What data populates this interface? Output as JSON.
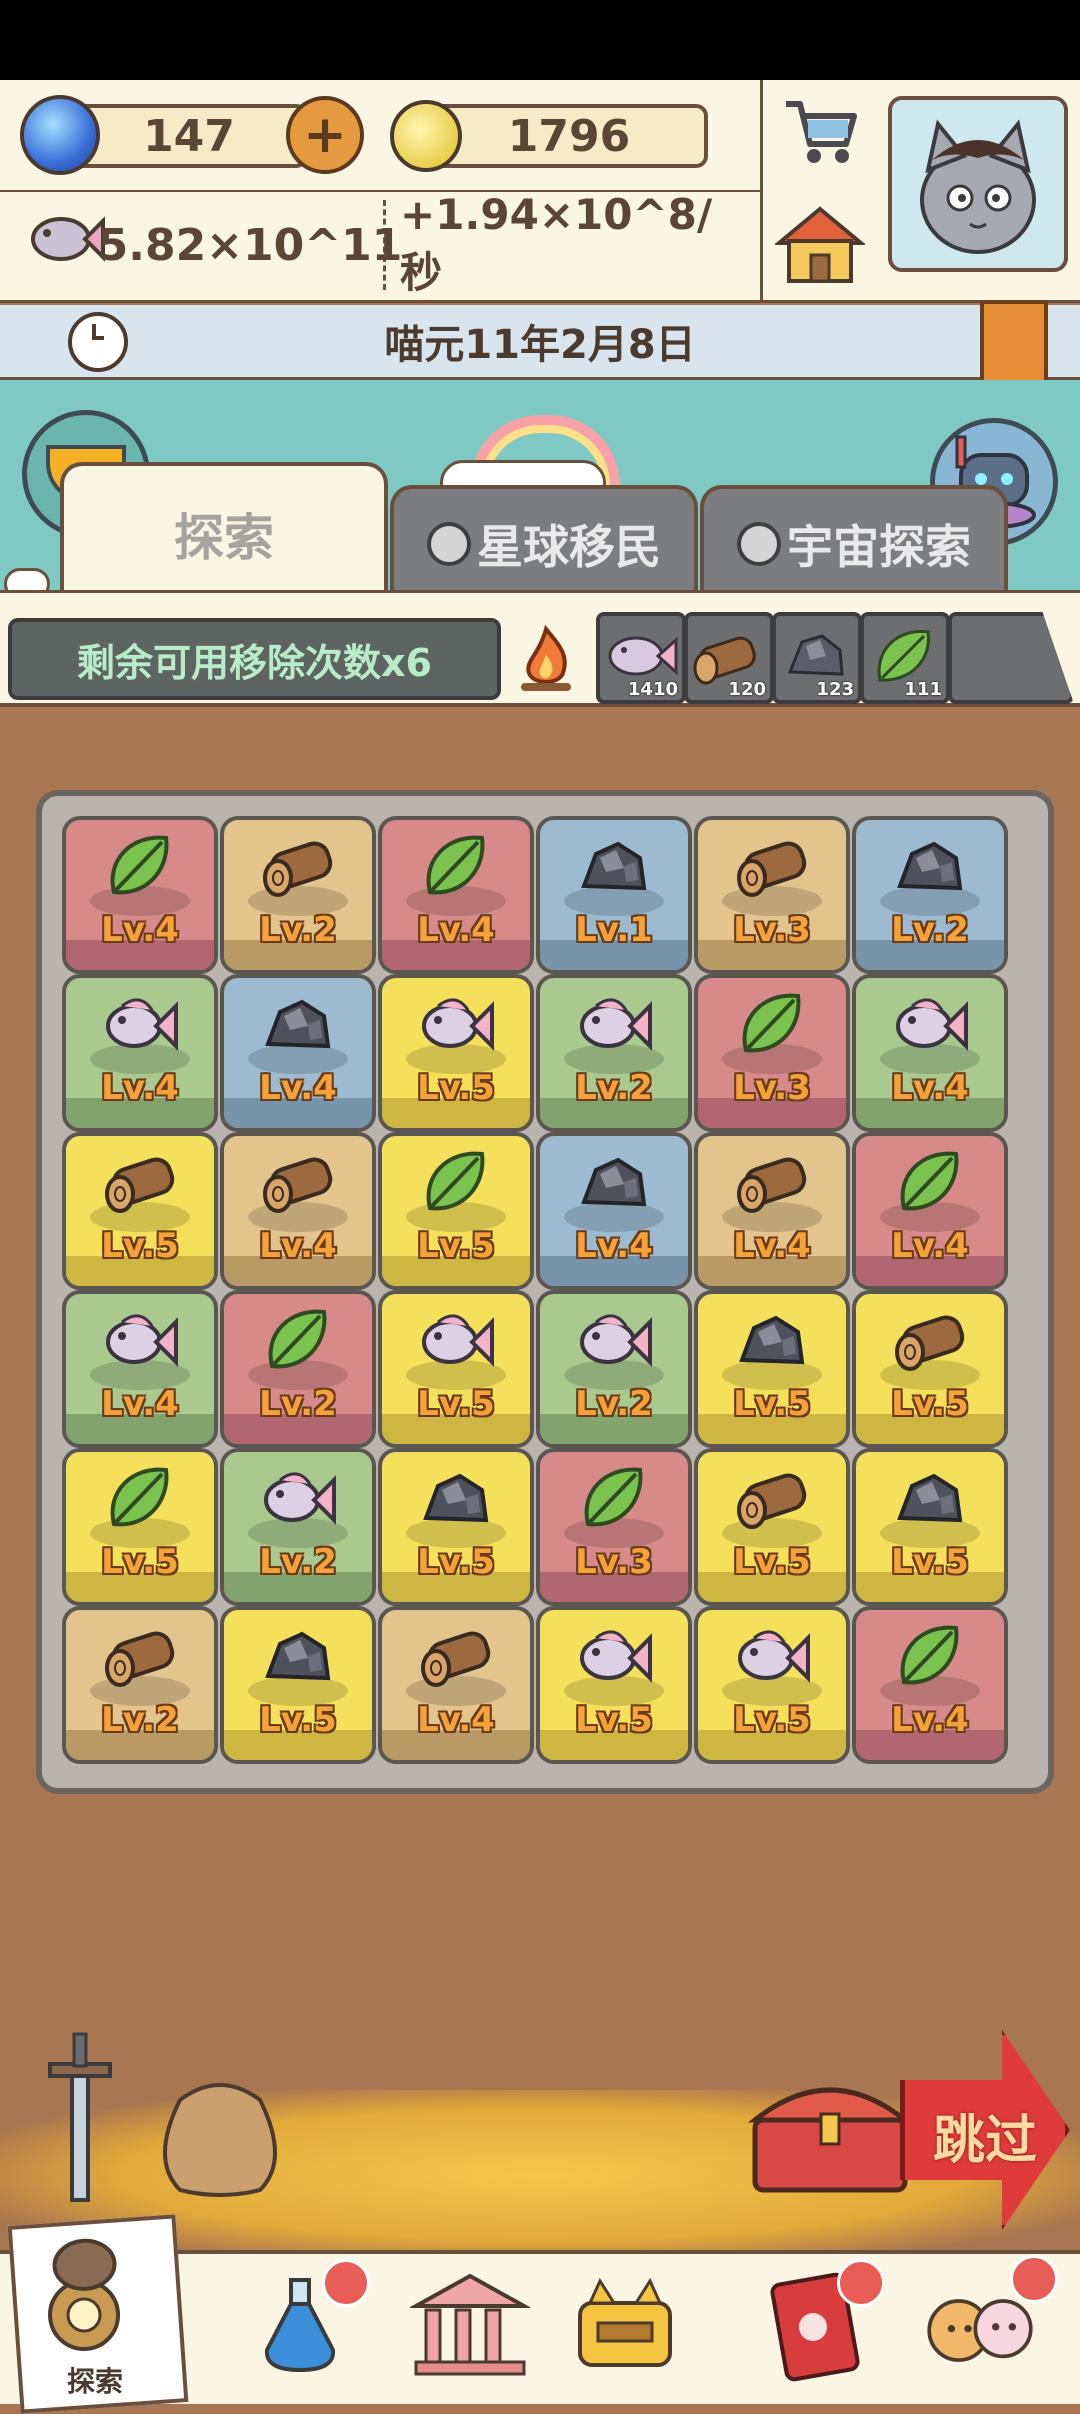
{
  "resources": {
    "gems": "147",
    "bulbs": "1796",
    "fish_total": "5.82×10^11",
    "fish_rate": "+1.94×10^8/秒"
  },
  "date": "喵元11年2月8日",
  "tabs": [
    {
      "label": "探索",
      "locked": false
    },
    {
      "label": "星球移民",
      "locked": true
    },
    {
      "label": "宇宙探索",
      "locked": true
    }
  ],
  "remove_count_label": "剩余可用移除次数x6",
  "inventory": [
    {
      "item": "fish",
      "count": "1410"
    },
    {
      "item": "wood",
      "count": "120"
    },
    {
      "item": "stone",
      "count": "123"
    },
    {
      "item": "leaf",
      "count": "111"
    },
    {
      "item": "empty",
      "count": ""
    }
  ],
  "board": [
    [
      {
        "item": "leaf",
        "color": "red",
        "level": "Lv.4"
      },
      {
        "item": "wood",
        "color": "tan",
        "level": "Lv.2"
      },
      {
        "item": "leaf",
        "color": "red",
        "level": "Lv.4"
      },
      {
        "item": "stone",
        "color": "blue",
        "level": "Lv.1"
      },
      {
        "item": "wood",
        "color": "tan",
        "level": "Lv.3"
      },
      {
        "item": "stone",
        "color": "blue",
        "level": "Lv.2"
      }
    ],
    [
      {
        "item": "fish",
        "color": "green",
        "level": "Lv.4"
      },
      {
        "item": "stone",
        "color": "blue",
        "level": "Lv.4"
      },
      {
        "item": "fish",
        "color": "yellow",
        "level": "Lv.5"
      },
      {
        "item": "fish",
        "color": "green",
        "level": "Lv.2"
      },
      {
        "item": "leaf",
        "color": "red",
        "level": "Lv.3"
      },
      {
        "item": "fish",
        "color": "green",
        "level": "Lv.4"
      }
    ],
    [
      {
        "item": "wood",
        "color": "yellow",
        "level": "Lv.5"
      },
      {
        "item": "wood",
        "color": "tan",
        "level": "Lv.4"
      },
      {
        "item": "leaf",
        "color": "yellow",
        "level": "Lv.5"
      },
      {
        "item": "stone",
        "color": "blue",
        "level": "Lv.4"
      },
      {
        "item": "wood",
        "color": "tan",
        "level": "Lv.4"
      },
      {
        "item": "leaf",
        "color": "red",
        "level": "Lv.4"
      }
    ],
    [
      {
        "item": "fish",
        "color": "green",
        "level": "Lv.4"
      },
      {
        "item": "leaf",
        "color": "red",
        "level": "Lv.2"
      },
      {
        "item": "fish",
        "color": "yellow",
        "level": "Lv.5"
      },
      {
        "item": "fish",
        "color": "green",
        "level": "Lv.2"
      },
      {
        "item": "stone",
        "color": "yellow",
        "level": "Lv.5"
      },
      {
        "item": "wood",
        "color": "yellow",
        "level": "Lv.5"
      }
    ],
    [
      {
        "item": "leaf",
        "color": "yellow",
        "level": "Lv.5"
      },
      {
        "item": "fish",
        "color": "green",
        "level": "Lv.2"
      },
      {
        "item": "stone",
        "color": "yellow",
        "level": "Lv.5"
      },
      {
        "item": "leaf",
        "color": "red",
        "level": "Lv.3"
      },
      {
        "item": "wood",
        "color": "yellow",
        "level": "Lv.5"
      },
      {
        "item": "stone",
        "color": "yellow",
        "level": "Lv.5"
      }
    ],
    [
      {
        "item": "wood",
        "color": "tan",
        "level": "Lv.2"
      },
      {
        "item": "stone",
        "color": "yellow",
        "level": "Lv.5"
      },
      {
        "item": "wood",
        "color": "tan",
        "level": "Lv.4"
      },
      {
        "item": "fish",
        "color": "yellow",
        "level": "Lv.5"
      },
      {
        "item": "fish",
        "color": "yellow",
        "level": "Lv.5"
      },
      {
        "item": "leaf",
        "color": "red",
        "level": "Lv.4"
      }
    ]
  ],
  "skip_label": "跳过",
  "bottom_nav": {
    "explore_label": "探索",
    "items": [
      "potion-icon",
      "museum-icon",
      "treasure-box-icon",
      "book-icon",
      "cats-icon"
    ]
  }
}
